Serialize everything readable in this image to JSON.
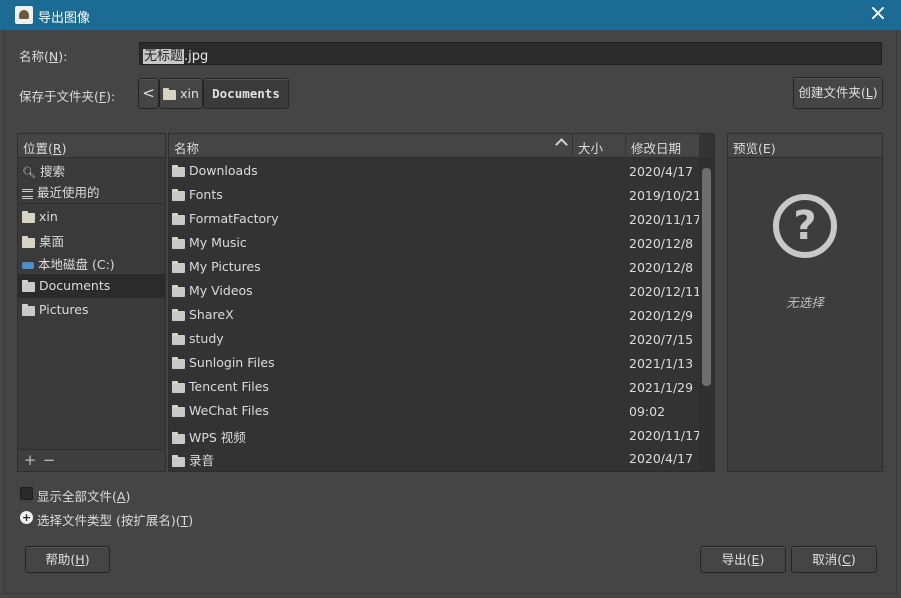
{
  "window": {
    "title": "导出图像",
    "close_glyph": "×"
  },
  "name_row": {
    "label_pre": "名称(",
    "label_key": "N",
    "label_post": "):",
    "selected": "无标题",
    "rest": ".jpg"
  },
  "folder_row": {
    "label_pre": "保存于文件夹(",
    "label_key": "F",
    "label_post": "):",
    "back_glyph": "<",
    "crumbs": [
      "xin",
      "Documents"
    ],
    "create_folder_pre": "创建文件夹(",
    "create_folder_key": "L",
    "create_folder_post": ")"
  },
  "places": {
    "header_pre": "位置(",
    "header_key": "R",
    "header_post": ")",
    "items": [
      {
        "label": "搜索",
        "icon": "search-icon"
      },
      {
        "label": "最近使用的",
        "icon": "recent-icon"
      },
      {
        "label": "xin",
        "icon": "folder-icon"
      },
      {
        "label": "桌面",
        "icon": "folder-icon"
      },
      {
        "label": "本地磁盘 (C:)",
        "icon": "drive-icon"
      },
      {
        "label": "Documents",
        "icon": "folder-icon",
        "selected": true
      },
      {
        "label": "Pictures",
        "icon": "folder-icon"
      }
    ],
    "add_glyph": "+",
    "remove_glyph": "−"
  },
  "files": {
    "columns": {
      "name": "名称",
      "size": "大小",
      "modified": "修改日期"
    },
    "rows": [
      {
        "name": "Downloads",
        "date": "2020/4/17"
      },
      {
        "name": "Fonts",
        "date": "2019/10/21"
      },
      {
        "name": "FormatFactory",
        "date": "2020/11/17"
      },
      {
        "name": "My Music",
        "date": "2020/12/8"
      },
      {
        "name": "My Pictures",
        "date": "2020/12/8"
      },
      {
        "name": "My Videos",
        "date": "2020/12/11"
      },
      {
        "name": "ShareX",
        "date": "2020/12/9"
      },
      {
        "name": "study",
        "date": "2020/7/15"
      },
      {
        "name": "Sunlogin Files",
        "date": "2021/1/13"
      },
      {
        "name": "Tencent Files",
        "date": "2021/1/29"
      },
      {
        "name": "WeChat Files",
        "date": "09:02"
      },
      {
        "name": "WPS 视频",
        "date": "2020/11/17"
      },
      {
        "name": "录音",
        "date": "2020/4/17"
      }
    ]
  },
  "preview": {
    "header": "预览(E)",
    "icon_glyph": "?",
    "none_text": "无选择"
  },
  "options": {
    "show_all_pre": "显示全部文件(",
    "show_all_key": "A",
    "show_all_post": ")",
    "file_type_pre": "选择文件类型 (按扩展名)(",
    "file_type_key": "T",
    "file_type_post": ")",
    "expander_glyph": "+"
  },
  "buttons": {
    "help_pre": "帮助(",
    "help_key": "H",
    "help_post": ")",
    "export_pre": "导出(",
    "export_key": "E",
    "export_post": ")",
    "cancel_pre": "取消(",
    "cancel_key": "C",
    "cancel_post": ")"
  }
}
